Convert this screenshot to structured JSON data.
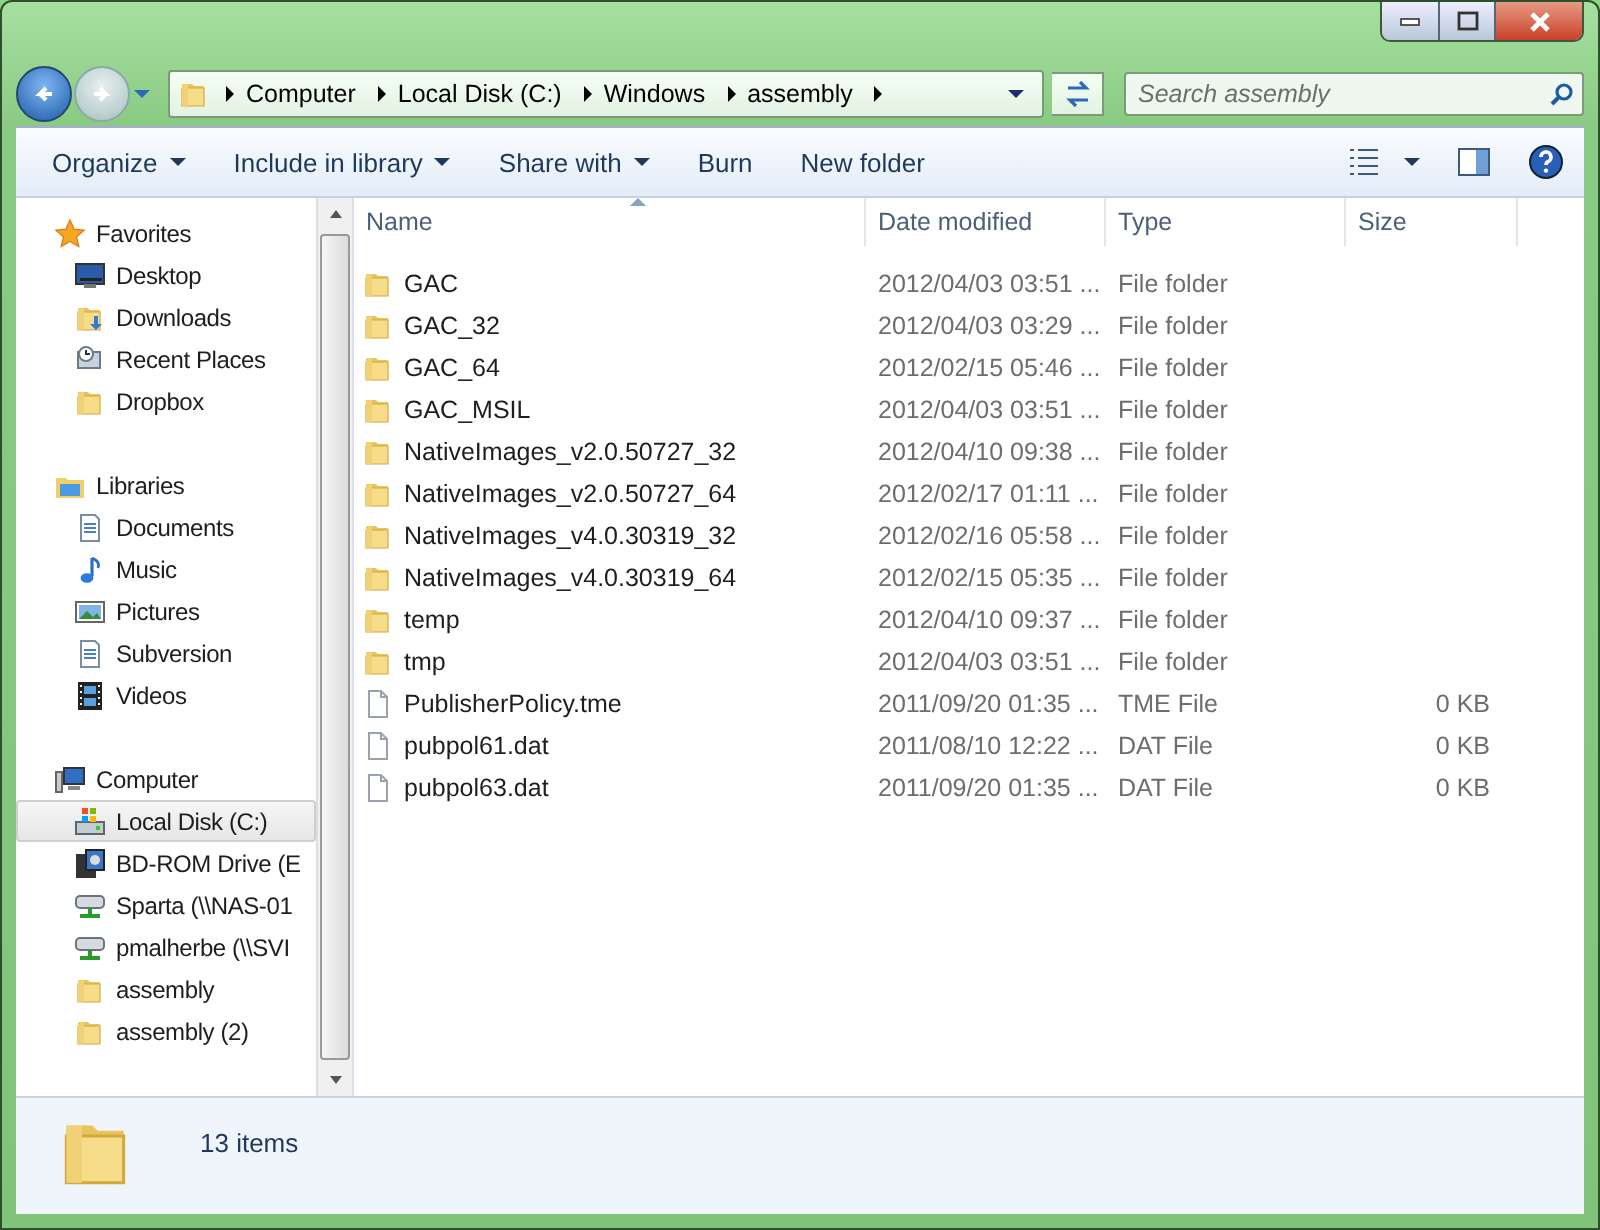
{
  "address": {
    "crumbs": [
      "Computer",
      "Local Disk (C:)",
      "Windows",
      "assembly"
    ],
    "search_placeholder": "Search assembly"
  },
  "toolbar": {
    "commands": [
      {
        "label": "Organize",
        "dropdown": true
      },
      {
        "label": "Include in library",
        "dropdown": true
      },
      {
        "label": "Share with",
        "dropdown": true
      },
      {
        "label": "Burn",
        "dropdown": false
      },
      {
        "label": "New folder",
        "dropdown": false
      }
    ]
  },
  "navigation": [
    {
      "label": "Favorites",
      "kind": "star",
      "children": [
        {
          "label": "Desktop",
          "kind": "desktop",
          "selected": false
        },
        {
          "label": "Downloads",
          "kind": "downloads",
          "selected": false
        },
        {
          "label": "Recent Places",
          "kind": "recent",
          "selected": false
        },
        {
          "label": "Dropbox",
          "kind": "folder",
          "selected": false
        }
      ]
    },
    {
      "label": "Libraries",
      "kind": "library",
      "children": [
        {
          "label": "Documents",
          "kind": "document",
          "selected": false
        },
        {
          "label": "Music",
          "kind": "music",
          "selected": false
        },
        {
          "label": "Pictures",
          "kind": "picture",
          "selected": false
        },
        {
          "label": "Subversion",
          "kind": "document",
          "selected": false
        },
        {
          "label": "Videos",
          "kind": "video",
          "selected": false
        }
      ]
    },
    {
      "label": "Computer",
      "kind": "computer",
      "children": [
        {
          "label": "Local Disk (C:)",
          "kind": "disk",
          "selected": true
        },
        {
          "label": "BD-ROM Drive (E",
          "kind": "optical",
          "selected": false
        },
        {
          "label": "Sparta (\\\\NAS-01",
          "kind": "netdrive",
          "selected": false
        },
        {
          "label": "pmalherbe (\\\\SVI",
          "kind": "netdrive",
          "selected": false
        },
        {
          "label": "assembly",
          "kind": "folder",
          "selected": false
        },
        {
          "label": "assembly (2)",
          "kind": "folder",
          "selected": false
        }
      ]
    }
  ],
  "table": {
    "columns": [
      "Name",
      "Date modified",
      "Type",
      "Size"
    ],
    "rows": [
      {
        "kind": "folder",
        "name": "GAC",
        "date": "2012/04/03 03:51 ...",
        "type": "File folder"
      },
      {
        "kind": "folder",
        "name": "GAC_32",
        "date": "2012/04/03 03:29 ...",
        "type": "File folder"
      },
      {
        "kind": "folder",
        "name": "GAC_64",
        "date": "2012/02/15 05:46 ...",
        "type": "File folder"
      },
      {
        "kind": "folder",
        "name": "GAC_MSIL",
        "date": "2012/04/03 03:51 ...",
        "type": "File folder"
      },
      {
        "kind": "folder",
        "name": "NativeImages_v2.0.50727_32",
        "date": "2012/04/10 09:38 ...",
        "type": "File folder"
      },
      {
        "kind": "folder",
        "name": "NativeImages_v2.0.50727_64",
        "date": "2012/02/17 01:11 ...",
        "type": "File folder"
      },
      {
        "kind": "folder",
        "name": "NativeImages_v4.0.30319_32",
        "date": "2012/02/16 05:58 ...",
        "type": "File folder"
      },
      {
        "kind": "folder",
        "name": "NativeImages_v4.0.30319_64",
        "date": "2012/02/15 05:35 ...",
        "type": "File folder"
      },
      {
        "kind": "folder",
        "name": "temp",
        "date": "2012/04/10 09:37 ...",
        "type": "File folder"
      },
      {
        "kind": "folder",
        "name": "tmp",
        "date": "2012/04/03 03:51 ...",
        "type": "File folder"
      },
      {
        "kind": "file",
        "name": "PublisherPolicy.tme",
        "date": "2011/09/20 01:35 ...",
        "type": "TME File",
        "size": "0 KB"
      },
      {
        "kind": "file",
        "name": "pubpol61.dat",
        "date": "2011/08/10 12:22 ...",
        "type": "DAT File",
        "size": "0 KB"
      },
      {
        "kind": "file",
        "name": "pubpol63.dat",
        "date": "2011/09/20 01:35 ...",
        "type": "DAT File",
        "size": "0 KB"
      }
    ]
  },
  "status_bar": {
    "text": "13 items"
  }
}
